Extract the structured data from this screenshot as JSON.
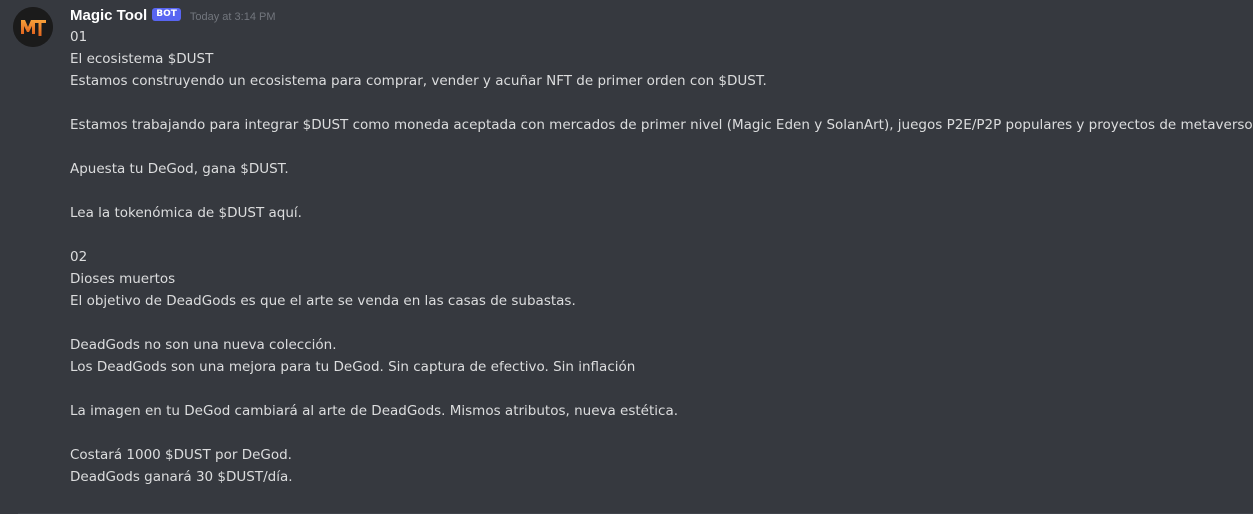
{
  "message": {
    "author": "Magic Tool",
    "bot_tag": "BOT",
    "timestamp": "Today at 3:14 PM",
    "avatar_icon": "magic-tool-mt-logo",
    "avatar_text": "MT",
    "lines": [
      "01",
      "El ecosistema $DUST",
      "Estamos construyendo un ecosistema para comprar, vender y acuñar NFT de primer orden con $DUST.",
      "",
      "Estamos trabajando para integrar $DUST como moneda aceptada con mercados de primer nivel (Magic Eden y SolanArt), juegos P2E/P2P populares y proyectos de metaverso.",
      "",
      "Apuesta tu DeGod, gana $DUST.",
      "",
      "Lea la tokenómica de $DUST aquí.",
      "",
      "02",
      "Dioses muertos",
      "El objetivo de DeadGods es que el arte se venda en las casas de subastas.",
      "",
      "DeadGods no son una nueva colección.",
      "Los DeadGods son una mejora para tu DeGod. Sin captura de efectivo. Sin inflación",
      "",
      "La imagen en tu DeGod cambiará al arte de DeadGods. Mismos atributos, nueva estética.",
      "",
      "Costará 1000 $DUST por DeGod.",
      "DeadGods ganará 30 $DUST/día."
    ]
  },
  "colors": {
    "background": "#36393f",
    "username": "#ffffff",
    "bot_tag": "#5865f2",
    "timestamp": "#72767d",
    "text": "#dcddde",
    "avatar_accent": "#f0872a"
  }
}
